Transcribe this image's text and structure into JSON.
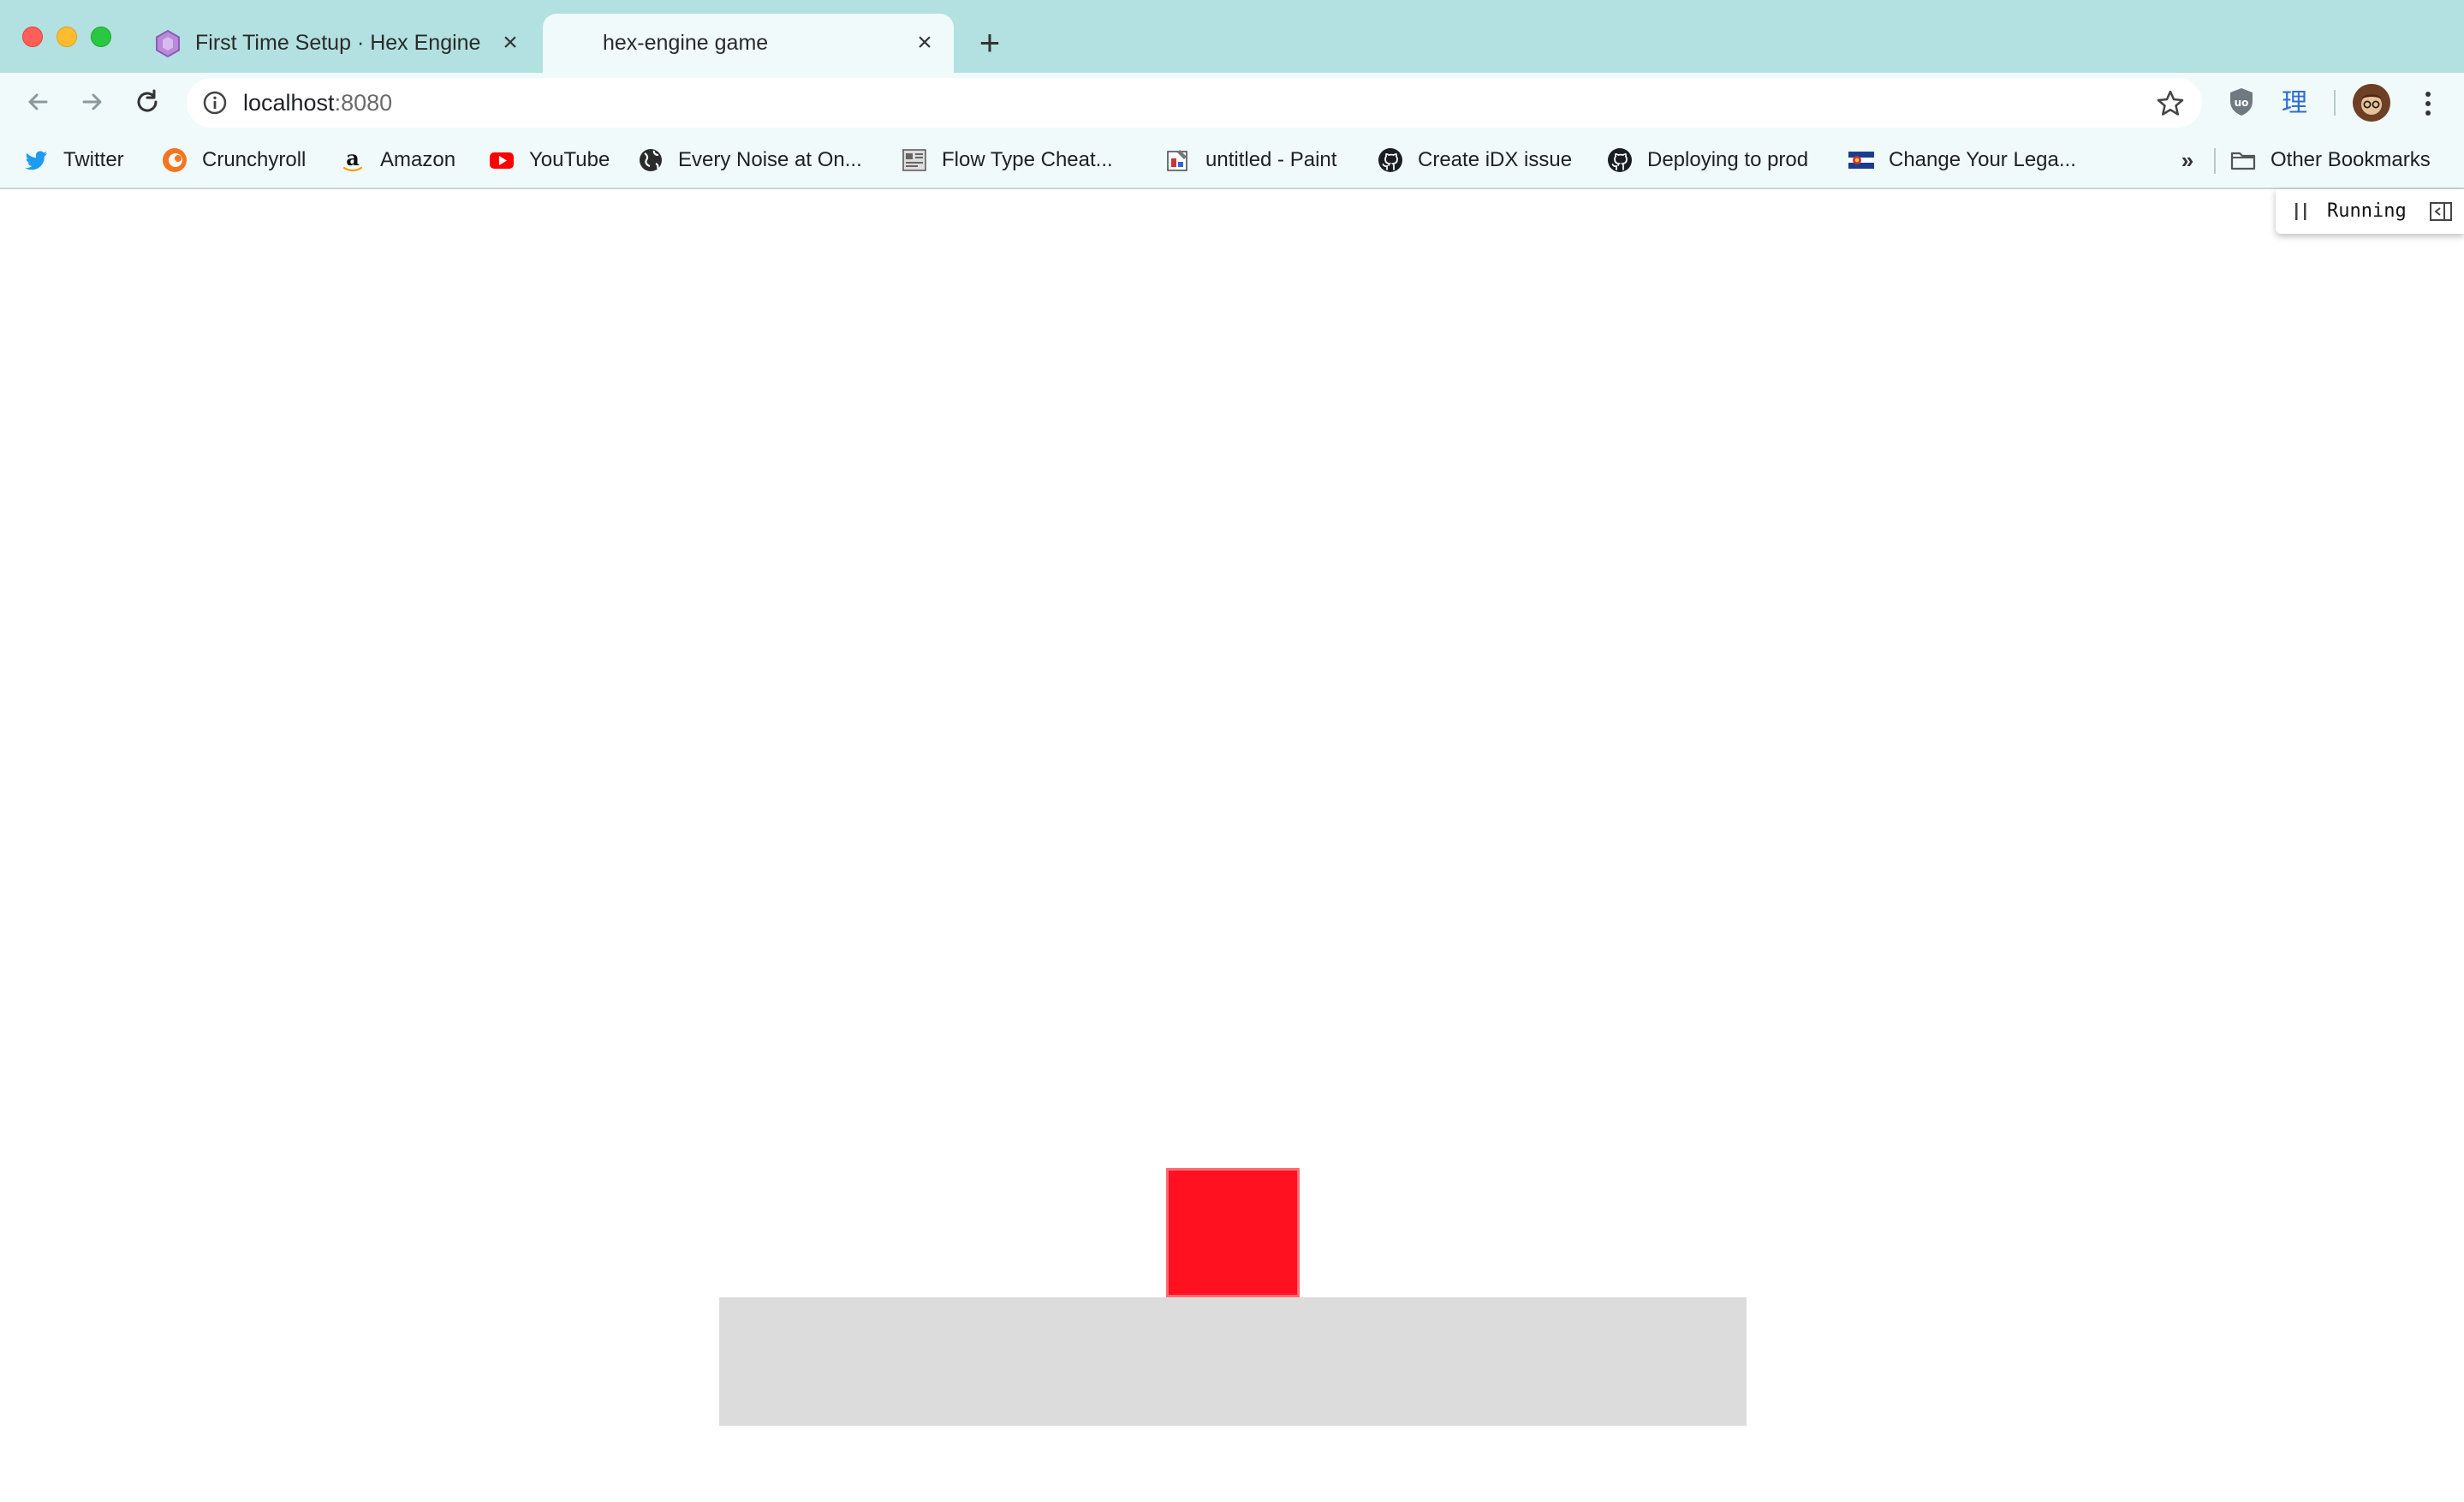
{
  "window": {
    "tabs": [
      {
        "title": "First Time Setup · Hex Engine",
        "favicon": "hex-engine-logo-icon",
        "active": false
      },
      {
        "title": "hex-engine game",
        "favicon": "",
        "active": true
      }
    ]
  },
  "toolbar": {
    "url_host": "localhost",
    "url_port": ":8080"
  },
  "bookmarks": {
    "items": [
      {
        "label": "Twitter",
        "icon": "twitter-icon"
      },
      {
        "label": "Crunchyroll",
        "icon": "crunchyroll-icon"
      },
      {
        "label": "Amazon",
        "icon": "amazon-icon"
      },
      {
        "label": "YouTube",
        "icon": "youtube-icon"
      },
      {
        "label": "Every Noise at On...",
        "icon": "globe-icon"
      },
      {
        "label": "Flow Type Cheat...",
        "icon": "page-thumbnail-icon"
      },
      {
        "label": "untitled - Paint",
        "icon": "paint-icon"
      },
      {
        "label": "Create iDX issue",
        "icon": "github-icon"
      },
      {
        "label": "Deploying to prod",
        "icon": "github-icon"
      },
      {
        "label": "Change Your Lega...",
        "icon": "flag-icon"
      }
    ],
    "more": "»",
    "other": "Other Bookmarks"
  },
  "devtools": {
    "status": "Running"
  },
  "game": {
    "colors": {
      "background": "#ffffff",
      "ground": "#dcdcdc",
      "player": "#ff111f",
      "tabstrip": "#b3e0e0",
      "toolbar": "#f0fafa"
    }
  }
}
